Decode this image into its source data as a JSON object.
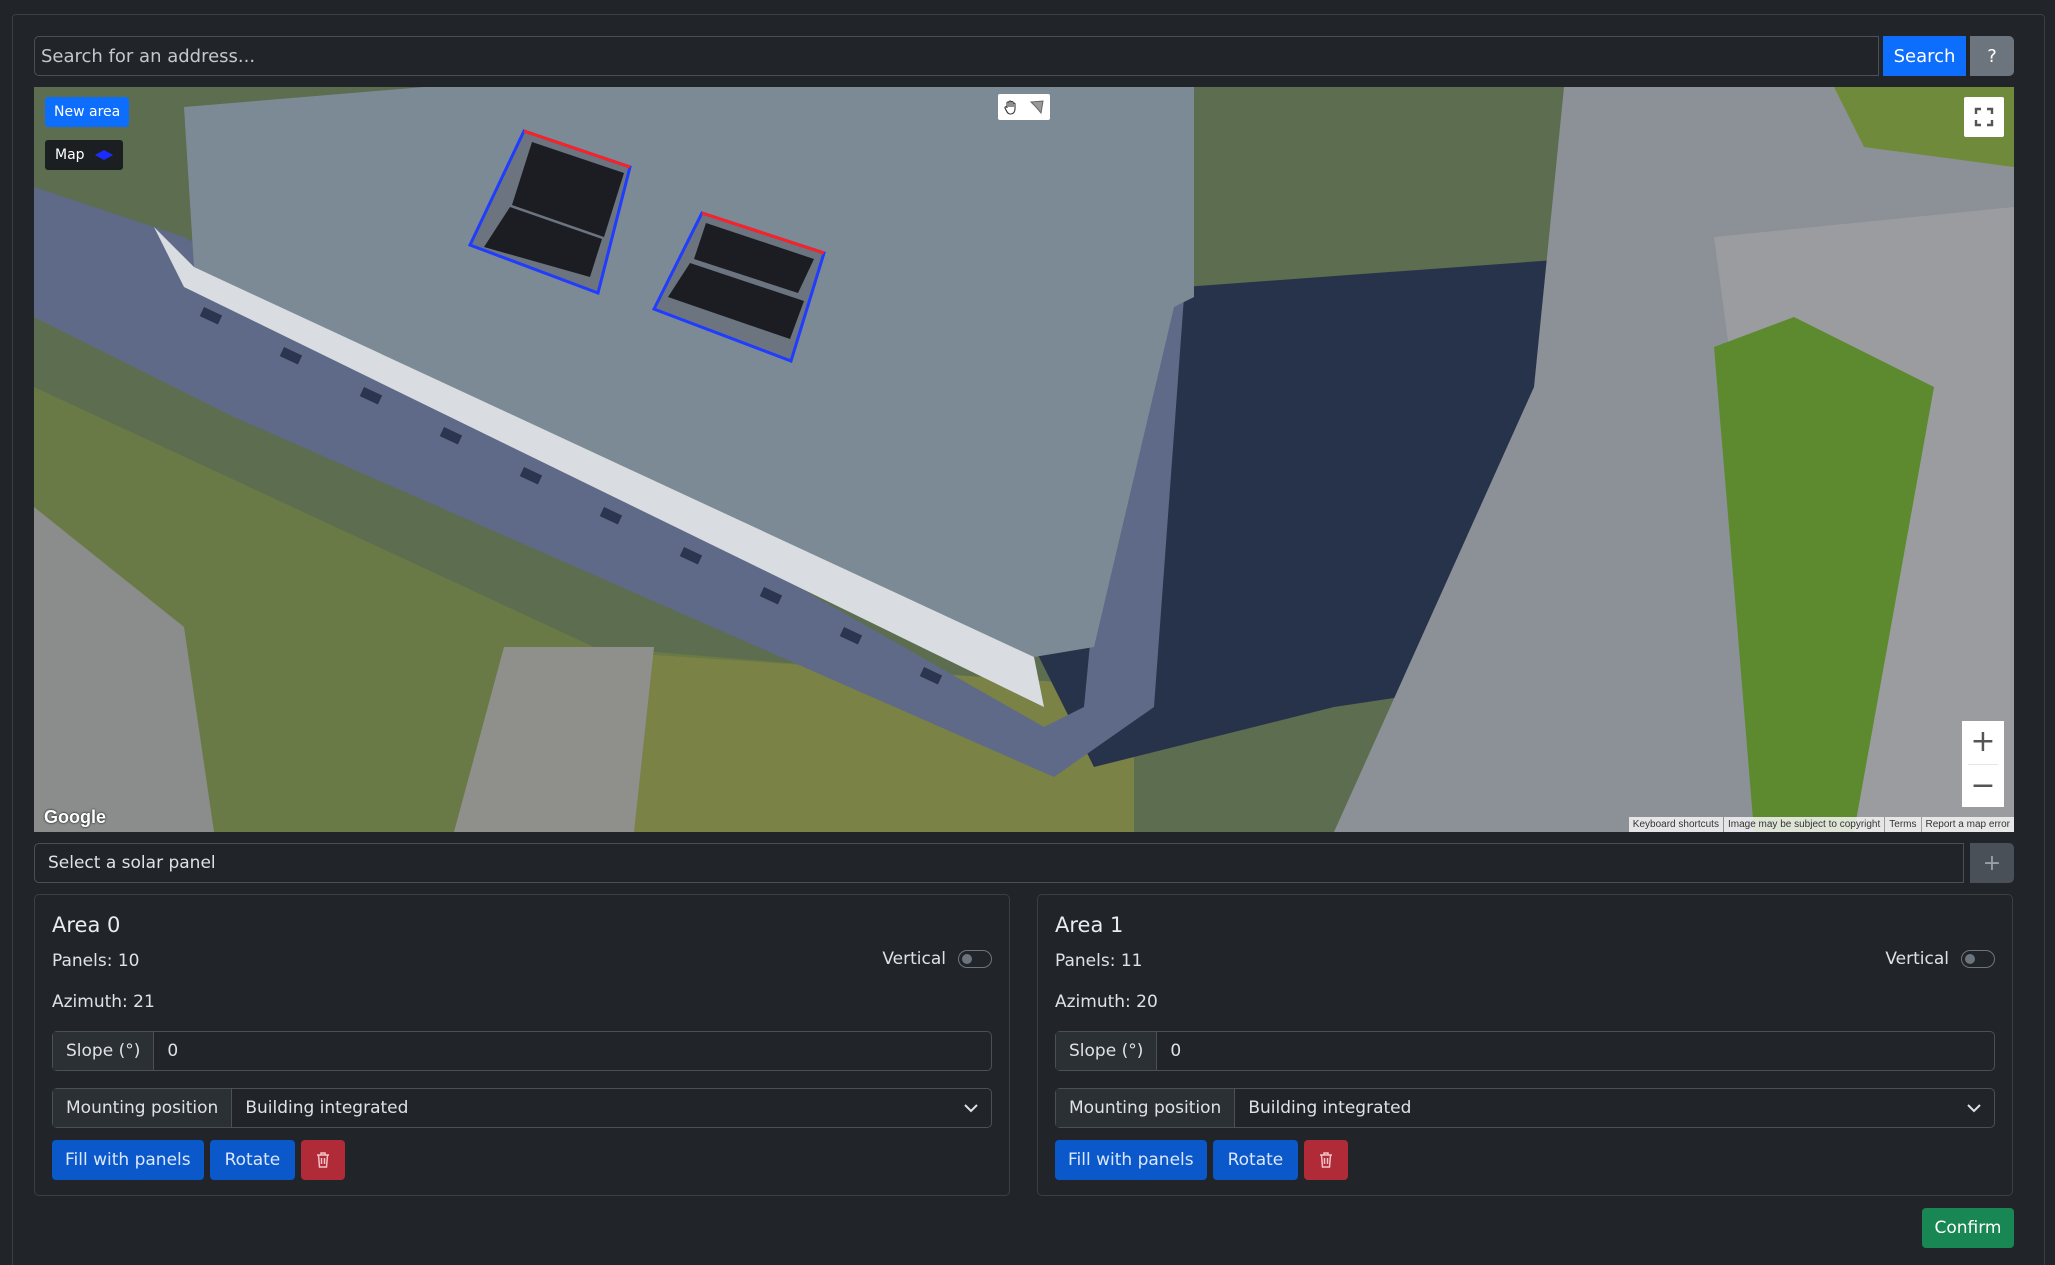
{
  "search": {
    "placeholder": "Search for an address...",
    "button_label": "Search",
    "help_label": "?"
  },
  "map": {
    "new_area_label": "New area",
    "layer_toggle_label": "Map",
    "logo": "Google",
    "attribution": [
      "Keyboard shortcuts",
      "Image may be subject to copyright",
      "Terms",
      "Report a map error"
    ],
    "zoom_in_label": "+",
    "zoom_out_label": "−",
    "icons": {
      "hand": "hand-icon",
      "draw": "draw-icon",
      "fullscreen": "fullscreen-icon"
    }
  },
  "panel_select": {
    "placeholder": "Select a solar panel",
    "add_label": "+"
  },
  "areas": [
    {
      "title": "Area 0",
      "panels": "Panels: 10",
      "azimuth": "Azimuth: 21",
      "vertical_label": "Vertical",
      "slope_label": "Slope (°)",
      "slope_value": "0",
      "mounting_label": "Mounting position",
      "mounting_value": "Building integrated",
      "fill_label": "Fill with panels",
      "rotate_label": "Rotate"
    },
    {
      "title": "Area 1",
      "panels": "Panels: 11",
      "azimuth": "Azimuth: 20",
      "vertical_label": "Vertical",
      "slope_label": "Slope (°)",
      "slope_value": "0",
      "mounting_label": "Mounting position",
      "mounting_value": "Building integrated",
      "fill_label": "Fill with panels",
      "rotate_label": "Rotate"
    }
  ],
  "confirm_label": "Confirm",
  "colors": {
    "primary": "#0d6efd",
    "danger": "#b02a37",
    "success": "#198754",
    "background": "#212529"
  }
}
